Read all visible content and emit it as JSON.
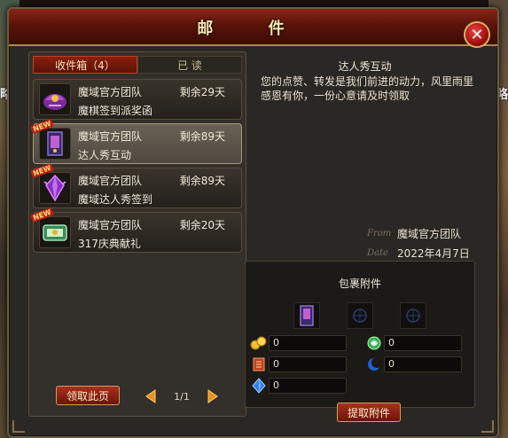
{
  "background": {
    "left_text": "略",
    "right_text": "略"
  },
  "window": {
    "title": "邮 件",
    "close_symbol": "✕"
  },
  "tabs": [
    {
      "label": "收件箱（4）",
      "active": true
    },
    {
      "label": "已  读",
      "active": false
    }
  ],
  "mails": [
    {
      "sender": "魔域官方团队",
      "days_left": "剩余29天",
      "subject": "魔棋签到派奖函",
      "is_new": false,
      "selected": false,
      "icon": "purple-chest-icon"
    },
    {
      "sender": "魔域官方团队",
      "days_left": "剩余89天",
      "subject": "达人秀互动",
      "is_new": true,
      "selected": true,
      "icon": "purple-card-icon"
    },
    {
      "sender": "魔域官方团队",
      "days_left": "剩余89天",
      "subject": "魔域达人秀签到",
      "is_new": true,
      "selected": false,
      "icon": "purple-crystal-icon"
    },
    {
      "sender": "魔域官方团队",
      "days_left": "剩余20天",
      "subject": "317庆典献礼",
      "is_new": true,
      "selected": false,
      "icon": "green-scroll-icon"
    }
  ],
  "new_badge": "NEW",
  "left_footer": {
    "claim_page_label": "领取此页",
    "page_indicator": "1/1"
  },
  "detail": {
    "title": "达人秀互动",
    "body": "您的点赞、转发是我们前进的动力，风里雨里感恩有你，一份心意请及时领取",
    "from_label": "From",
    "from_value": "魔域官方团队",
    "date_label": "Date",
    "date_value": "2022年4月7日"
  },
  "attachments": {
    "title": "包裹附件",
    "slots": [
      "purple-card-icon",
      "empty-slot",
      "empty-slot"
    ],
    "resources": [
      {
        "icon": "gold-coins-icon",
        "value": "0"
      },
      {
        "icon": "green-orb-icon",
        "value": "0"
      },
      {
        "icon": "red-scroll-icon",
        "value": "0"
      },
      {
        "icon": "blue-moon-icon",
        "value": "0"
      },
      {
        "icon": "blue-gem-icon",
        "value": "0"
      }
    ],
    "extract_label": "提取附件"
  },
  "colors": {
    "title_bar": "#5a1408",
    "accent_gold": "#d0a050",
    "button_red": "#a83020"
  }
}
